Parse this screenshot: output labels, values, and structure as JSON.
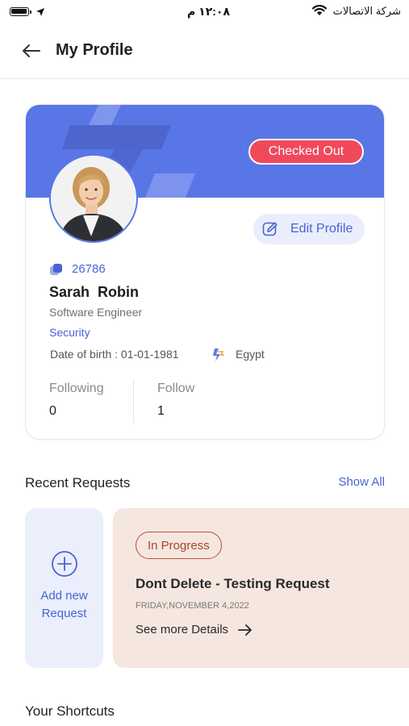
{
  "status_bar": {
    "time": "١٢:٠٨ م",
    "carrier": "شركة الاتصالات"
  },
  "header": {
    "title": "My Profile"
  },
  "profile": {
    "status": "Checked Out",
    "edit_label": "Edit Profile",
    "employee_id": "26786",
    "name": "Sarah  Robin",
    "job_title": "Software Engineer",
    "department": "Security",
    "date_of_birth": "Date of birth : 01-01-1981",
    "country": "Egypt",
    "stats": [
      {
        "label": "Following",
        "value": "0"
      },
      {
        "label": "Follow",
        "value": "1"
      }
    ],
    "colors": {
      "banner": "#5876e6",
      "status_pill": "#f0495c",
      "accent": "#4863d4"
    }
  },
  "recent_requests": {
    "title": "Recent Requests",
    "show_all": "Show All",
    "add_label": "Add new Request",
    "items": [
      {
        "status": "In Progress",
        "title": "Dont Delete - Testing Request",
        "date": "FRIDAY,NOVEMBER 4,2022",
        "more": "See more Details"
      }
    ]
  },
  "shortcuts": {
    "title": "Your Shortcuts"
  }
}
